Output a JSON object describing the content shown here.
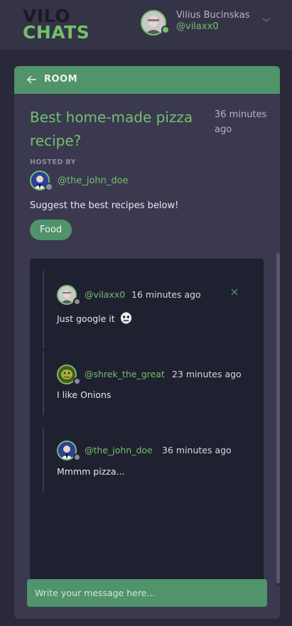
{
  "header": {
    "logo_line1": "VILO",
    "logo_line2": "CHATS",
    "user_name": "Vilius Bucinskas",
    "user_handle": "@vilaxx0"
  },
  "room": {
    "back_label": "ROOM",
    "title": "Best home-made pizza recipe?",
    "created": "36 minutes ago",
    "hosted_by_label": "HOSTED BY",
    "host_handle": "@the_john_doe",
    "description": "Suggest the best recipes below!",
    "topic": "Food"
  },
  "messages": [
    {
      "handle": "@vilaxx0",
      "time": "16 minutes ago",
      "body": "Just google it",
      "can_delete": true,
      "has_emoji": true
    },
    {
      "handle": "@shrek_the_great",
      "time": "23 minutes ago",
      "body": "I like Onions",
      "can_delete": false
    },
    {
      "handle": "@the_john_doe",
      "time": "36 minutes ago",
      "body": "Mmmm pizza...",
      "can_delete": false
    }
  ],
  "composer": {
    "placeholder": "Write your message here..."
  },
  "colors": {
    "background": "#2a2939",
    "header": "#353447",
    "card": "#3a3950",
    "accent": "#73c06a",
    "accent_dark": "#51936b",
    "conversation": "#1f2030"
  },
  "icons": {
    "back": "arrow-left-icon",
    "menu": "chevron-down-icon",
    "delete": "close-icon",
    "emoji": "ghost-emoji-icon"
  }
}
